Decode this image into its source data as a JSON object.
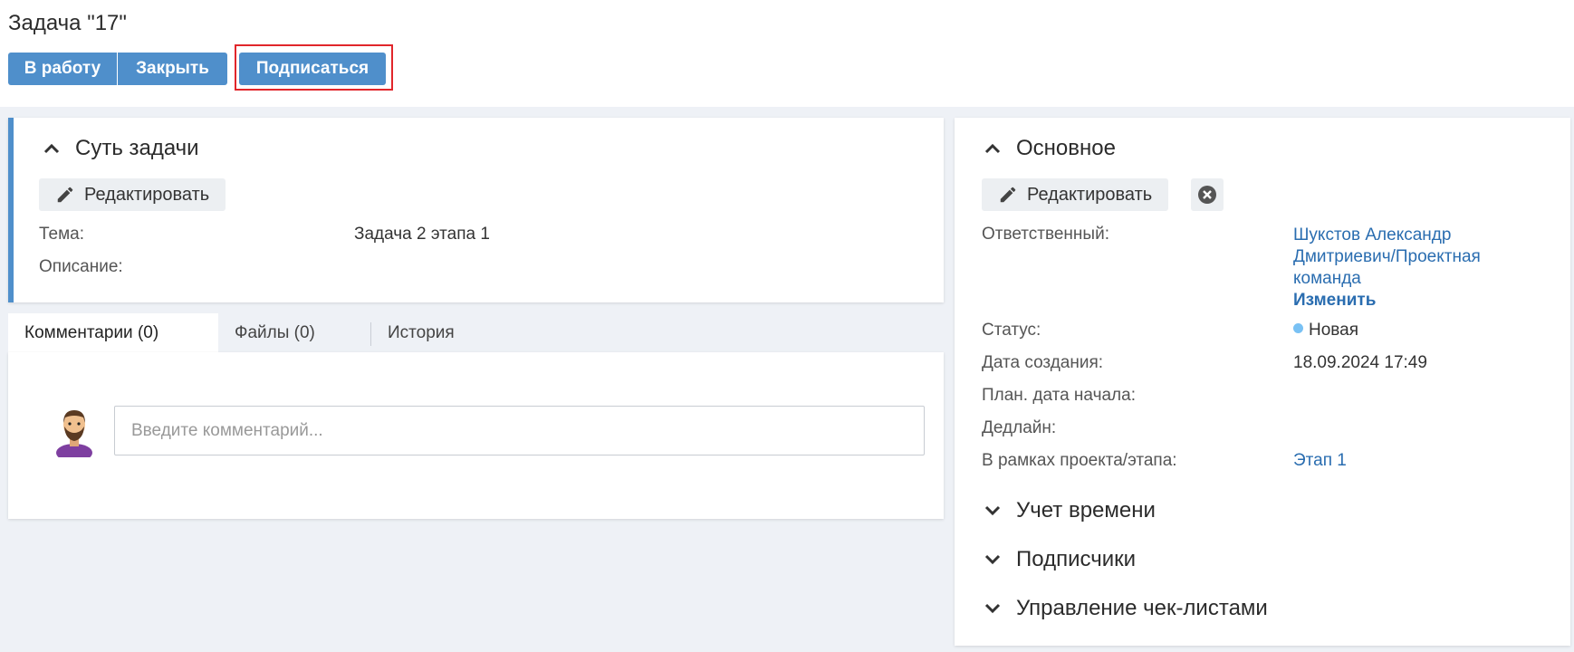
{
  "header": {
    "title": "Задача \"17\"",
    "buttons": {
      "work": "В работу",
      "close": "Закрыть",
      "subscribe": "Подписаться"
    }
  },
  "essence": {
    "title": "Суть задачи",
    "edit_label": "Редактировать",
    "fields": [
      {
        "label": "Тема:",
        "value": "Задача 2 этапа 1"
      },
      {
        "label": "Описание:",
        "value": ""
      }
    ]
  },
  "tabs": [
    {
      "label": "Комментарии (0)",
      "active": true
    },
    {
      "label": "Файлы (0)",
      "active": false
    },
    {
      "label": "История",
      "active": false
    }
  ],
  "comments": {
    "placeholder": "Введите комментарий..."
  },
  "main": {
    "title": "Основное",
    "edit_label": "Редактировать",
    "responsible_label": "Ответственный:",
    "responsible_lines": [
      "Шукстов Александр",
      "Дмитриевич/Проектная",
      "команда"
    ],
    "change_label": "Изменить",
    "status_label": "Статус:",
    "status_value": "Новая",
    "status_color": "#79c1f4",
    "created_label": "Дата создания:",
    "created_value": "18.09.2024 17:49",
    "plan_start_label": "План. дата начала:",
    "deadline_label": "Дедлайн:",
    "project_label": "В рамках проекта/этапа:",
    "project_value": "Этап 1"
  },
  "collapsed_sections": [
    {
      "title": "Учет времени"
    },
    {
      "title": "Подписчики"
    },
    {
      "title": "Управление чек-листами"
    }
  ],
  "colors": {
    "accent": "#4f8fcb",
    "link": "#2a6db0",
    "highlight": "#e1262b",
    "background": "#eef1f6"
  },
  "icons": [
    "pencil-icon",
    "chevron-up-icon",
    "chevron-down-icon",
    "close-circle-icon",
    "avatar-icon"
  ]
}
